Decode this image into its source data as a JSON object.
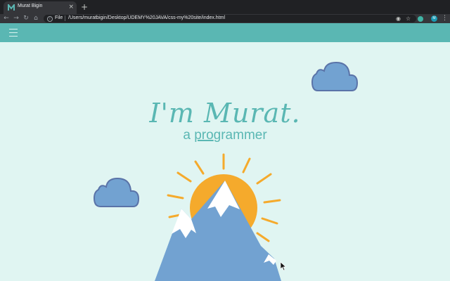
{
  "browser": {
    "tab_title": "Murat Bigin",
    "tab_close": "×",
    "new_tab": "+",
    "nav_icons": [
      "back-icon",
      "forward-icon",
      "reload-icon",
      "home-icon"
    ],
    "address_scheme": "File",
    "address_url": "/Users/muratbigin/Desktop/UDEMY%20JAVA/css-my%20site/index.html",
    "avatar_letter": "M"
  },
  "site": {
    "nav_icon": "hamburger-icon",
    "headline": "I'm Murat.",
    "subline_pre": "a ",
    "subline_under": "pro",
    "subline_post": "grammer"
  },
  "colors": {
    "nav_bar": "#5ab7b3",
    "background": "#e0f5f2",
    "cloud": "#72a2d1",
    "mountain": "#72a2d1",
    "sun": "#f5aa2c",
    "text": "#5ab7b3"
  }
}
